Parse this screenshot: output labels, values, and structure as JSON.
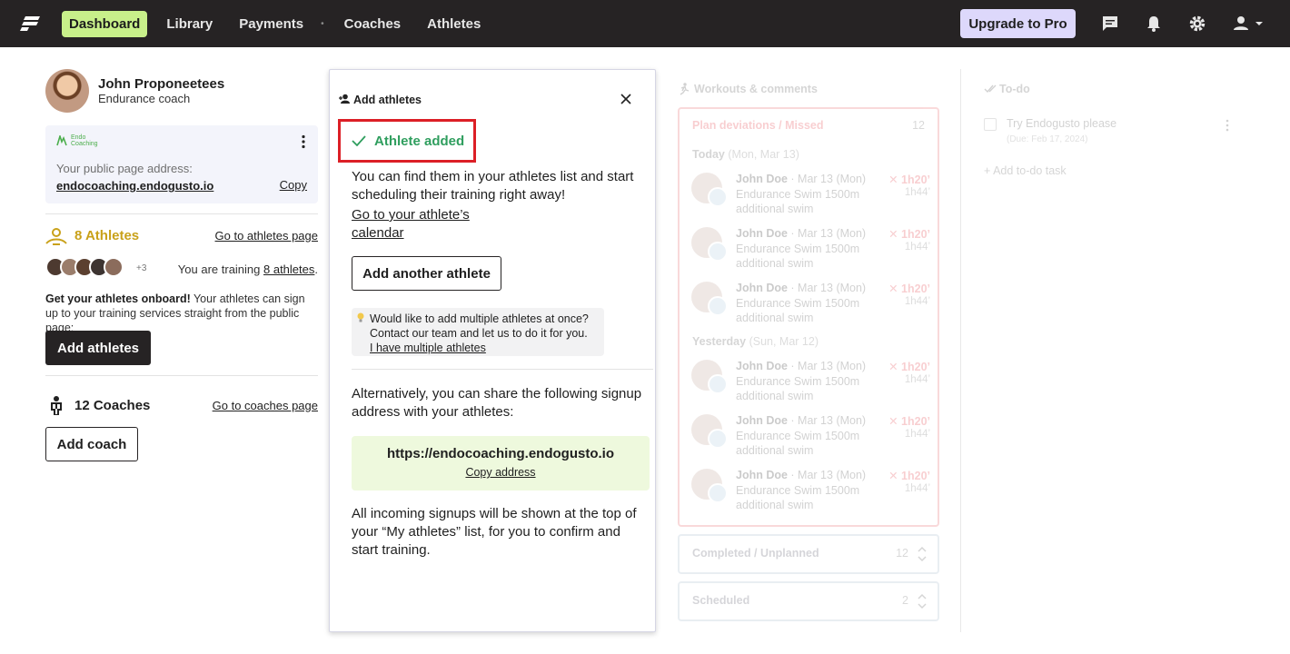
{
  "topbar": {
    "nav": [
      "Dashboard",
      "Library",
      "Payments",
      "Coaches",
      "Athletes"
    ],
    "separator": "•",
    "upgrade_label": "Upgrade to Pro"
  },
  "coach": {
    "name": "John Proponeetees",
    "role": "Endurance coach"
  },
  "public_page": {
    "logo_text_1": "Endo",
    "logo_text_2": "Coaching",
    "label": "Your public page address:",
    "url": "endocoaching.endogusto.io",
    "copy_label": "Copy"
  },
  "athletes_section": {
    "count_label": "8 Athletes",
    "go_link": "Go to athletes page",
    "more_count": "+3",
    "training_prefix": "You are training ",
    "training_link": "8 athletes",
    "training_suffix": ".",
    "onboard_bold": "Get your athletes onboard!",
    "onboard_text": " Your athletes can sign up to your training services straight from the public page:",
    "add_button": "Add athletes"
  },
  "coaches_section": {
    "count_label": "12 Coaches",
    "go_link": "Go to coaches page",
    "add_button": "Add coach"
  },
  "panel": {
    "title": "Add athletes",
    "status": "Athlete added",
    "intro": "You can find them in your athletes list and start scheduling their training right away!",
    "calendar_link_1": "Go to your athlete’s",
    "calendar_link_2": "calendar",
    "add_another": "Add another athlete",
    "tip_text": "Would like to add multiple athletes at once? Contact our team and let us to do it for you.",
    "tip_link": "I have multiple athletes",
    "alt_text": "Alternatively, you can share the following signup address with your athletes:",
    "signup_url": "https://endocoaching.endogusto.io",
    "copy_address": "Copy address",
    "incoming_text": "All incoming signups will be shown at the top of your “My athletes” list, for you to confirm and start training."
  },
  "workouts": {
    "title": "Workouts & comments",
    "plan_header": "Plan deviations / Missed",
    "plan_count": "12",
    "days": [
      {
        "label": "Today",
        "date": "(Mon, Mar 13)"
      },
      {
        "label": "Yesterday",
        "date": "(Sun, Mar 12)"
      }
    ],
    "items": [
      {
        "name": "John Doe",
        "date": " · Mar 13 (Mon)",
        "line1": "Endurance Swim 1500m",
        "line2": "additional swim",
        "planned": "1h20’",
        "actual": "1h44’"
      },
      {
        "name": "John Doe",
        "date": " · Mar 13 (Mon)",
        "line1": "Endurance Swim 1500m",
        "line2": "additional swim",
        "planned": "1h20’",
        "actual": "1h44’"
      },
      {
        "name": "John Doe",
        "date": " · Mar 13 (Mon)",
        "line1": "Endurance Swim 1500m",
        "line2": "additional swim",
        "planned": "1h20’",
        "actual": "1h44’"
      },
      {
        "name": "John Doe",
        "date": " · Mar 13 (Mon)",
        "line1": "Endurance Swim 1500m",
        "line2": "additional swim",
        "planned": "1h20’",
        "actual": "1h44’"
      },
      {
        "name": "John Doe",
        "date": " · Mar 13 (Mon)",
        "line1": "Endurance Swim 1500m",
        "line2": "additional swim",
        "planned": "1h20’",
        "actual": "1h44’"
      },
      {
        "name": "John Doe",
        "date": " · Mar 13 (Mon)",
        "line1": "Endurance Swim 1500m",
        "line2": "additional swim",
        "planned": "1h20’",
        "actual": "1h44’"
      }
    ],
    "completed_label": "Completed / Unplanned",
    "completed_count": "12",
    "scheduled_label": "Scheduled",
    "scheduled_count": "2"
  },
  "todo": {
    "title": "To-do",
    "item_text": "Try Endogusto please",
    "item_due": "(Due: Feb 17, 2024)",
    "add_label": "+ Add to-do task"
  },
  "colors": {
    "topbar": "#262324",
    "active_nav": "#c8f08a",
    "upgrade": "#ddd8fb",
    "success": "#2f9e5e",
    "highlight": "#dc1f26",
    "athletes_gold": "#c9a11a"
  }
}
